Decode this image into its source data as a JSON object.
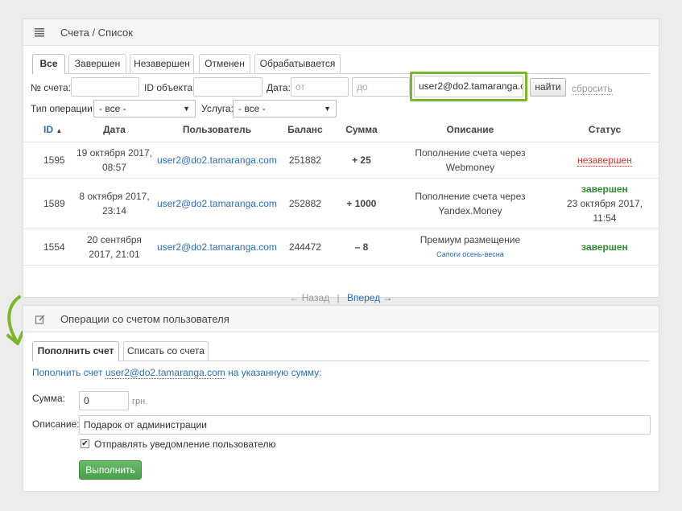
{
  "top_panel": {
    "title": "Счета / Список",
    "tabs": [
      "Все",
      "Завершен",
      "Незавершен",
      "Отменен",
      "Обрабатывается"
    ],
    "filters": {
      "account_label": "№ счета:",
      "account_value": "",
      "object_label": "ID объекта:",
      "object_value": "",
      "date_label": "Дата:",
      "date_from_placeholder": "от",
      "date_to_placeholder": "до",
      "user_value": "user2@do2.tamaranga.c",
      "find_label": "найти",
      "reset_label": "сбросить",
      "optype_label": "Тип операции:",
      "optype_value": "- все -",
      "service_label": "Услуга:",
      "service_value": "- все -"
    },
    "table": {
      "headers": {
        "id": "ID",
        "sort": "▲",
        "date": "Дата",
        "user": "Пользователь",
        "balance": "Баланс",
        "sum": "Сумма",
        "desc": "Описание",
        "status": "Статус"
      },
      "rows": [
        {
          "id": "1595",
          "date1": "19 октября 2017,",
          "date2": "08:57",
          "user": "user2@do2.tamaranga.com",
          "balance": "251882",
          "sum": "+ 25",
          "desc": "Пополнение счета через Webmoney",
          "desc_sub": "",
          "status": "незавершен",
          "status_date1": "",
          "status_date2": ""
        },
        {
          "id": "1589",
          "date1": "8 октября 2017,",
          "date2": "23:14",
          "user": "user2@do2.tamaranga.com",
          "balance": "252882",
          "sum": "+ 1000",
          "desc": "Пополнение счета через Yandex.Money",
          "desc_sub": "",
          "status": "завершен",
          "status_date1": "23 октября 2017,",
          "status_date2": "11:54"
        },
        {
          "id": "1554",
          "date1": "20 сентября",
          "date2": "2017, 21:01",
          "user": "user2@do2.tamaranga.com",
          "balance": "244472",
          "sum": "– 8",
          "desc": "Премиум размещение",
          "desc_sub": "Сапоги осень-весна",
          "status": "завершен",
          "status_date1": "",
          "status_date2": ""
        }
      ]
    },
    "pager": {
      "prev": "← Назад",
      "sep": "|",
      "next": "Вперед →"
    }
  },
  "ops_panel": {
    "title": "Операции со счетом пользователя",
    "tabs": [
      "Пополнить счет",
      "Списать со счета"
    ],
    "info_prefix": "Пополнить счет",
    "info_account": "user2@do2.tamaranga.com",
    "info_suffix": "на указанную сумму:",
    "sum_label": "Сумма:",
    "sum_value": "0",
    "currency": "грн.",
    "desc_label": "Описание:",
    "desc_value": "Подарок от администрации",
    "notify_label": "Отправлять уведомление пользователю",
    "notify_checked": "✔",
    "submit_label": "Выполнить"
  },
  "colors": {
    "accent_green": "#7ab829",
    "link_blue": "#2a6ebb",
    "ok_green": "#2e8b2e",
    "error_red": "#d9302c"
  }
}
